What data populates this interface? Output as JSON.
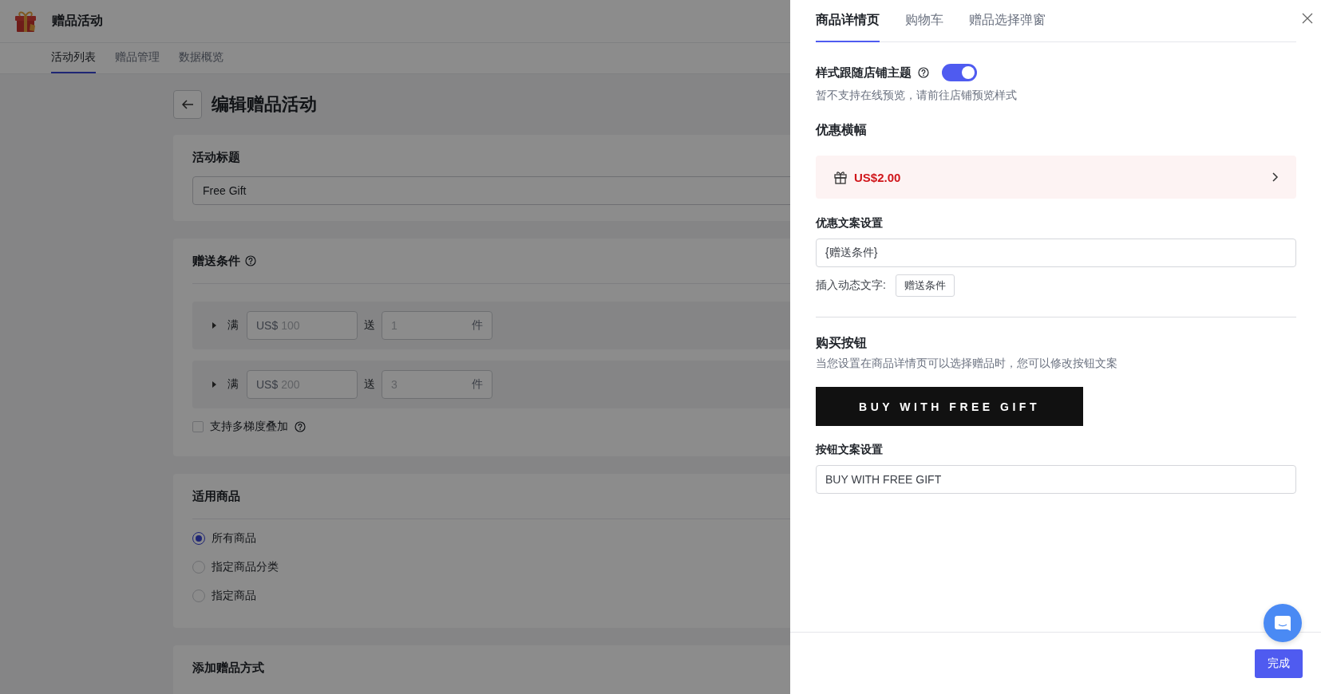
{
  "app": {
    "title": "赠品活动"
  },
  "nav_tabs": [
    {
      "label": "活动列表",
      "selected": true
    },
    {
      "label": "赠品管理",
      "selected": false
    },
    {
      "label": "数据概览",
      "selected": false
    }
  ],
  "page": {
    "title": "编辑赠品活动"
  },
  "title_card": {
    "heading": "活动标题",
    "value": "Free Gift"
  },
  "condition_card": {
    "heading": "赠送条件",
    "tiers": [
      {
        "expanded": false,
        "label": "满",
        "amount": {
          "prefix": "US$",
          "placeholder": "100"
        },
        "give": "送",
        "quantity": {
          "placeholder": "1",
          "suffix": "件"
        }
      },
      {
        "expanded": false,
        "label": "满",
        "amount": {
          "prefix": "US$",
          "placeholder": "200"
        },
        "give": "送",
        "quantity": {
          "placeholder": "3",
          "suffix": "件"
        }
      }
    ],
    "stacking": {
      "label": "支持多梯度叠加",
      "checked": false
    }
  },
  "products_card": {
    "heading": "适用商品",
    "options": [
      {
        "label": "所有商品",
        "selected": true
      },
      {
        "label": "指定商品分类",
        "selected": false
      },
      {
        "label": "指定商品",
        "selected": false
      }
    ]
  },
  "gift_method_card": {
    "heading": "添加赠品方式"
  },
  "drawer": {
    "tabs": [
      {
        "label": "商品详情页",
        "selected": true
      },
      {
        "label": "购物车",
        "selected": false
      },
      {
        "label": "赠品选择弹窗",
        "selected": false
      }
    ],
    "theme_toggle": {
      "label": "样式跟随店铺主题",
      "on": true,
      "note": "暂不支持在线预览，请前往店铺预览样式"
    },
    "banner_section": {
      "heading": "优惠横幅",
      "banner_text": "US$2.00"
    },
    "copy_setting": {
      "label": "优惠文案设置",
      "value": "{赠送条件}",
      "insert_label": "插入动态文字:",
      "tokens": [
        "赠送条件"
      ]
    },
    "buy_button": {
      "heading": "购买按钮",
      "description": "当您设置在商品详情页可以选择赠品时，您可以修改按钮文案",
      "preview_label": "BUY WITH FREE GIFT",
      "field_label": "按钮文案设置",
      "value": "BUY WITH FREE GIFT"
    },
    "footer": {
      "done": "完成"
    }
  }
}
